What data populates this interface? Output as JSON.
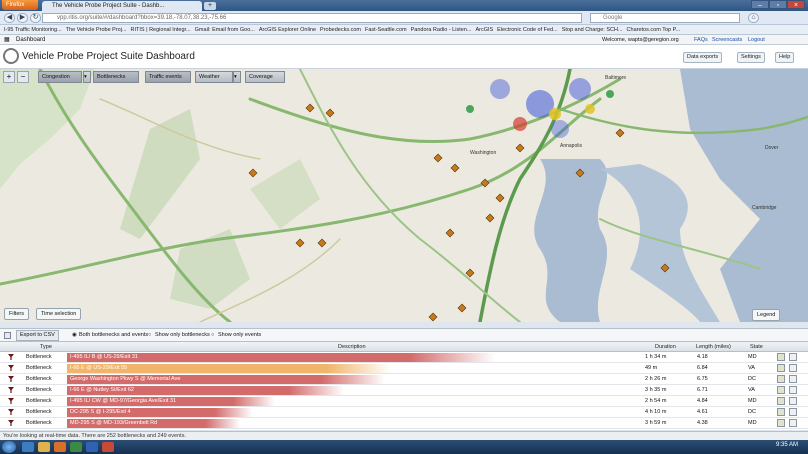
{
  "browser": {
    "menu_label": "Firefox",
    "tab_title": "The Vehicle Probe Project Suite - Dashb...",
    "new_tab": "+",
    "url": "vpp.ritis.org/suite/#/dashboard?bbox=39.18,-78.07,38.23,-75.66",
    "search_placeholder": "Google",
    "bookmarks": [
      "I-95 Traffic Monitoring...",
      "The Vehicle Probe Proj...",
      "RITIS | Regional Integr...",
      "Gmail: Email from Goo...",
      "ArcGIS Explorer Online",
      "Probedecks.com",
      "Fast-Seattle.com",
      "Pandora Radio - Listen...",
      "ArcGIS",
      "Electronic Code of Fed...",
      "Stop and Charge: SCH...",
      "Charetos.com Top P..."
    ],
    "page_tab": "Dashboard",
    "welcome": "Welcome, wapts@geregion.org",
    "header_links": [
      "FAQs",
      "Screencasts",
      "Logout"
    ]
  },
  "app": {
    "title": "Vehicle Probe Project Suite Dashboard",
    "buttons": {
      "data_exports": "Data exports",
      "settings": "Settings",
      "help": "Help"
    }
  },
  "map": {
    "zoom_in": "+",
    "zoom_out": "−",
    "layers": [
      "Congestion",
      "Bottlenecks",
      "Traffic events",
      "Weather",
      "Coverage"
    ],
    "filters": "Filters",
    "time_selection": "Time selection",
    "legend": "Legend",
    "place_labels": [
      "Baltimore",
      "Washington",
      "Dover",
      "Cambridge",
      "Annapolis"
    ]
  },
  "table": {
    "export": "Export to CSV",
    "filter_options": [
      "Both bottlenecks and events",
      "Show only bottlenecks",
      "Show only events"
    ],
    "headers": {
      "type": "Type",
      "description": "Description",
      "duration": "Duration",
      "length": "Length (miles)",
      "state": "State"
    },
    "rows": [
      {
        "type": "Bottleneck",
        "description": "I-495 IL/ B @ US-29/Exit 31",
        "duration": "1 h 34 m",
        "length": "4.18",
        "state": "MD",
        "severity": 0.74,
        "color": "#d36b6b"
      },
      {
        "type": "Bottleneck",
        "description": "I-66 E @ US-29/Exit 55",
        "duration": "49 m",
        "length": "6.84",
        "state": "VA",
        "severity": 0.56,
        "color": "#f0b46a"
      },
      {
        "type": "Bottleneck",
        "description": "George Washington Pkwy S @ Memorial Ave",
        "duration": "2 h 26 m",
        "length": "6.75",
        "state": "DC",
        "severity": 0.55,
        "color": "#d36b6b"
      },
      {
        "type": "Bottleneck",
        "description": "I-66 E @ Nutley St/Exit 62",
        "duration": "3 h 35 m",
        "length": "6.71",
        "state": "VA",
        "severity": 0.48,
        "color": "#d36b6b"
      },
      {
        "type": "Bottleneck",
        "description": "I-495 IL/ CW @ MD-97/Georgia Ave/Exit 31",
        "duration": "2 h 54 m",
        "length": "4.84",
        "state": "MD",
        "severity": 0.36,
        "color": "#d36b6b"
      },
      {
        "type": "Bottleneck",
        "description": "DC-295 S @ I-295/Exit 4",
        "duration": "4 h 10 m",
        "length": "4.61",
        "state": "DC",
        "severity": 0.32,
        "color": "#d36b6b"
      },
      {
        "type": "Bottleneck",
        "description": "MD-295 S @ MD-193/Greenbelt Rd",
        "duration": "3 h 59 m",
        "length": "4.38",
        "state": "MD",
        "severity": 0.3,
        "color": "#d36b6b"
      }
    ],
    "status": "You're looking at real-time data. There are 252 bottlenecks and 249 events."
  },
  "taskbar": {
    "clock": "9:35 AM"
  }
}
